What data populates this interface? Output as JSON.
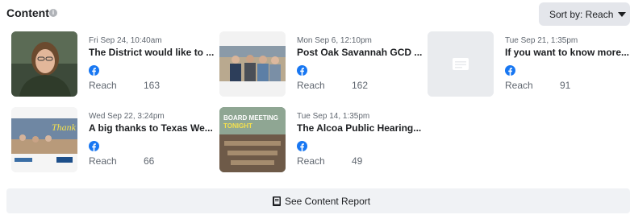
{
  "header": {
    "title": "Content",
    "info_glyph": "i",
    "sort_label": "Sort by: Reach"
  },
  "posts": [
    {
      "date": "Fri Sep 24, 10:40am",
      "title": "The District would like to ...",
      "metric_label": "Reach",
      "metric_value": "163",
      "thumbnail": "portrait-photo"
    },
    {
      "date": "Mon Sep 6, 12:10pm",
      "title": "Post Oak Savannah GCD ...",
      "metric_label": "Reach",
      "metric_value": "162",
      "thumbnail": "group-photo"
    },
    {
      "date": "Tue Sep 21, 1:35pm",
      "title": "If you want to know more...",
      "metric_label": "Reach",
      "metric_value": "91",
      "thumbnail": "text-post-placeholder"
    },
    {
      "date": "Wed Sep 22, 3:24pm",
      "title": "A big thanks to Texas We...",
      "metric_label": "Reach",
      "metric_value": "66",
      "thumbnail": "thank-you-graphic"
    },
    {
      "date": "Tue Sep 14, 1:35pm",
      "title": "The Alcoa Public Hearing...",
      "metric_label": "Reach",
      "metric_value": "49",
      "thumbnail": "board-meeting-photo"
    }
  ],
  "thumb_texts": {
    "thanks": "Thank",
    "board_meeting": "BOARD MEETING",
    "tonight": "TONIGHT"
  },
  "footer": {
    "report_label": "See Content Report"
  },
  "colors": {
    "facebook_blue": "#1877f2",
    "secondary_text": "#606770",
    "button_bg": "#e4e6eb",
    "footer_bg": "#f0f2f5"
  },
  "icons": {
    "info": "info-icon",
    "sort_caret": "caret-down-icon",
    "platform": "facebook-icon",
    "report": "report-book-icon"
  }
}
